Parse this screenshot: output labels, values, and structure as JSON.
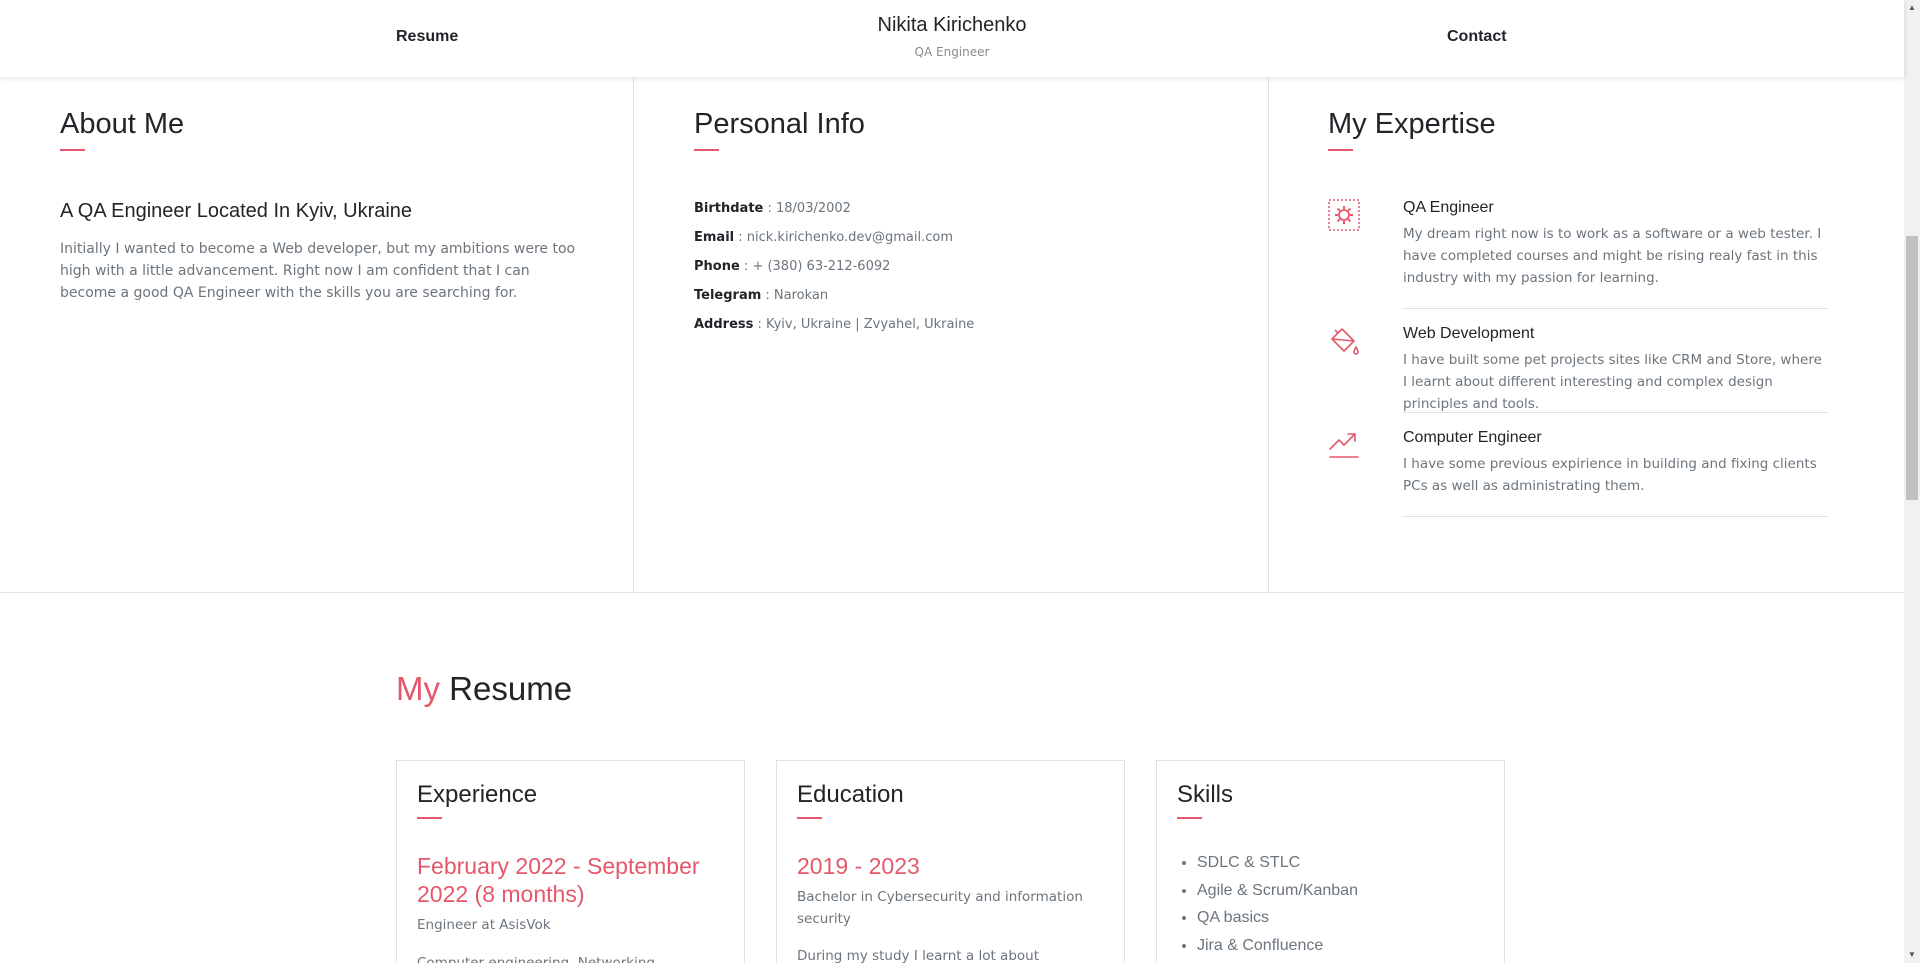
{
  "header": {
    "nav_left": "Resume",
    "nav_right": "Contact",
    "name": "Nikita Kirichenko",
    "role": "QA Engineer"
  },
  "about": {
    "title": "About Me",
    "subtitle": "A QA Engineer Located In Kyiv, Ukraine",
    "text": "Initially I wanted to become a Web developer, but my ambitions were too high with a little advancement. Right now I am confident that I can become a good QA Engineer with the skills you are searching for."
  },
  "personal": {
    "title": "Personal Info",
    "rows": [
      {
        "label": "Birthdate",
        "value": " : 18/03/2002"
      },
      {
        "label": "Email",
        "value": " : nick.kirichenko.dev@gmail.com"
      },
      {
        "label": "Phone",
        "value": " : + (380) 63-212-6092"
      },
      {
        "label": "Telegram",
        "value": " : Narokan"
      },
      {
        "label": "Address",
        "value": " : Kyiv, Ukraine | Zvyahel, Ukraine"
      }
    ]
  },
  "expertise": {
    "title": "My Expertise",
    "items": [
      {
        "icon": "gear-icon",
        "title": "QA Engineer",
        "text": "My dream right now is to work as a software or a web tester. I have completed courses and might be rising realy fast in this industry with my passion for learning."
      },
      {
        "icon": "paint-bucket-icon",
        "title": "Web Development",
        "text": "I have built some pet projects sites like CRM and Store, where I learnt about different interesting and complex design principles and tools."
      },
      {
        "icon": "trending-up-icon",
        "title": "Computer Engineer",
        "text": "I have some previous expirience in building and fixing clients PCs as well as administrating them."
      }
    ]
  },
  "resume": {
    "title_accent": "My",
    "title_rest": " Resume",
    "experience": {
      "title": "Experience",
      "period": "February 2022 - September 2022 (8 months)",
      "position": "Engineer at AsisVok",
      "details": "Computer engineering, Networking, Customers"
    },
    "education": {
      "title": "Education",
      "period": "2019 - 2023",
      "degree": "Bachelor in Cybersecurity and information security",
      "details": "During my study I learnt a lot about Programming"
    },
    "skills": {
      "title": "Skills",
      "items": [
        "SDLC & STLC",
        "Agile & Scrum/Kanban",
        "QA basics",
        "Jira & Confluence"
      ]
    }
  },
  "colors": {
    "accent": "#e5586b",
    "text": "#212529",
    "muted": "#6c757d",
    "border": "#dee2e6"
  }
}
